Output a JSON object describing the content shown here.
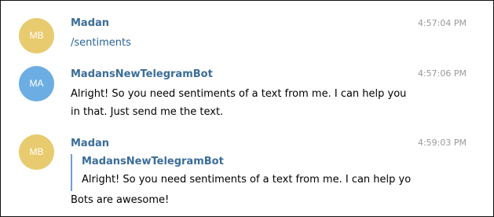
{
  "messages": [
    {
      "avatar_initials": "MB",
      "avatar_color": "#e8cb6f",
      "sender": "Madan",
      "time": "4:57:04 PM",
      "text": "/sentiments"
    },
    {
      "avatar_initials": "MA",
      "avatar_color": "#6caee3",
      "sender": "MadansNewTelegramBot",
      "time": "4:57:06 PM",
      "text_line1": "Alright! So you need sentiments of a text from me. I can help you",
      "text_line2": "in that. Just send me the text."
    },
    {
      "avatar_initials": "MB",
      "avatar_color": "#e8cb6f",
      "sender": "Madan",
      "time": "4:59:03 PM",
      "reply": {
        "sender": "MadansNewTelegramBot",
        "text": "Alright! So you need sentiments of a text from me. I can help yo"
      },
      "text": "Bots are awesome!"
    }
  ],
  "colors": {
    "sender_name": "#3a6d99",
    "timestamp": "#999999",
    "reply_bar": "#6f9fcf",
    "command_link": "#2a6497"
  }
}
